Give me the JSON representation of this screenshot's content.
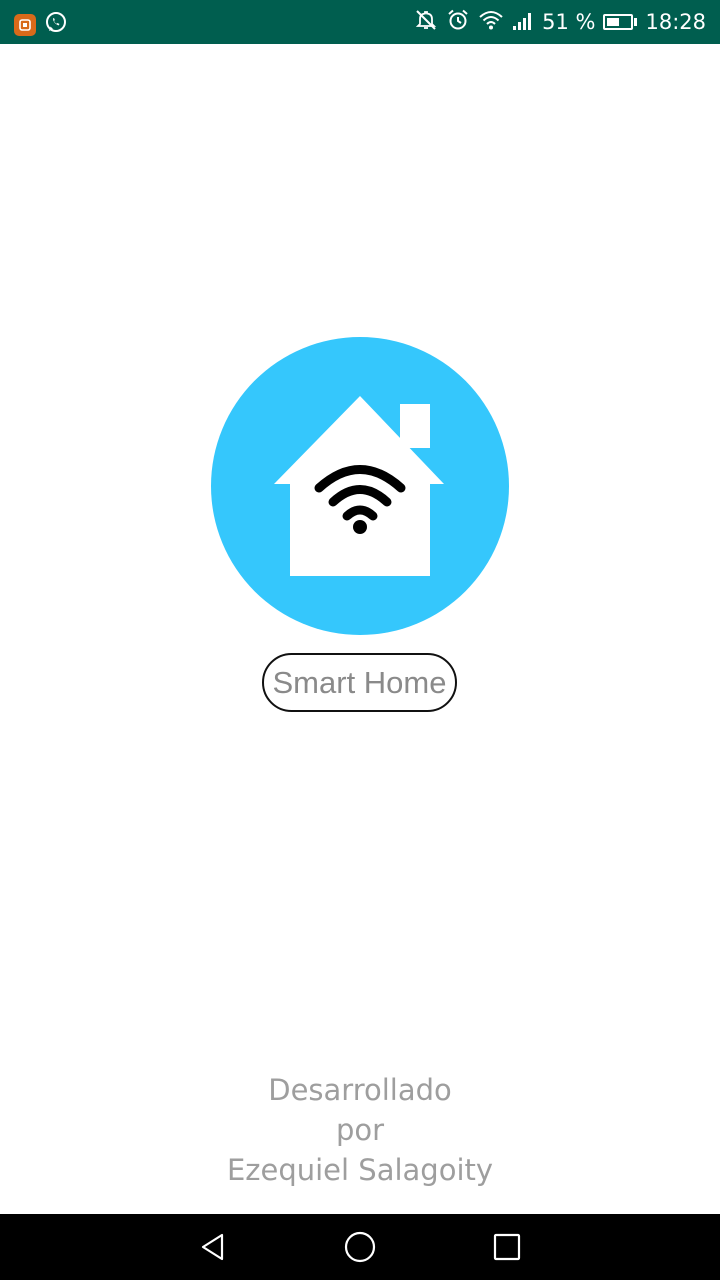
{
  "status_bar": {
    "battery_percent": "51 %",
    "battery_level": 0.51,
    "time": "18:28",
    "notification_icons": [
      "app-notification-icon",
      "whatsapp-icon"
    ],
    "status_icons": [
      "mute-icon",
      "alarm-icon",
      "wifi-icon",
      "signal-icon",
      "battery-icon"
    ],
    "background_color": "#005e4f"
  },
  "main": {
    "logo_icon": "smart-home-wifi-icon",
    "logo_color": "#35c7fc",
    "title": "Smart Home"
  },
  "credits": {
    "line1": "Desarrollado",
    "line2": "por",
    "line3": "Ezequiel Salagoity"
  },
  "nav_bar": {
    "buttons": [
      "back-icon",
      "home-icon",
      "recents-icon"
    ]
  }
}
